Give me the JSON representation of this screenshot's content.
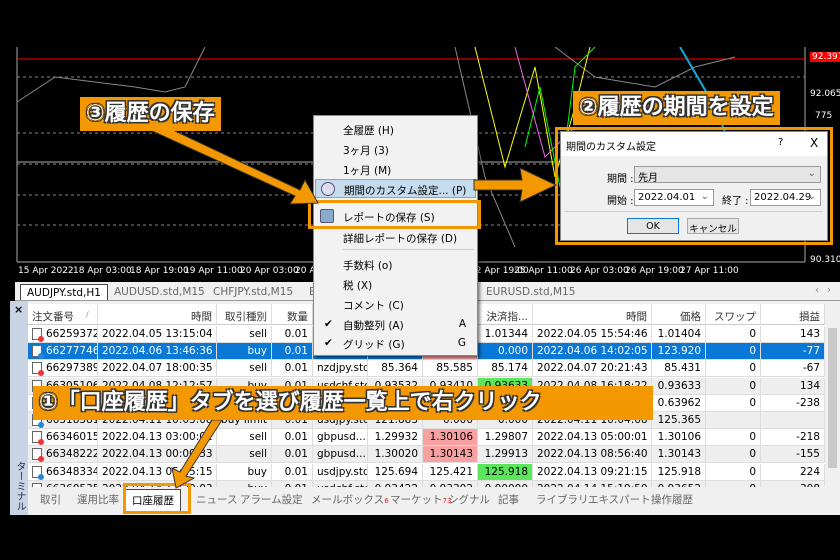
{
  "chart": {
    "price_labels": [
      "92.397",
      "92.065",
      "775",
      "90.310"
    ],
    "bid_line_color": "#ff0000",
    "time_labels": [
      "15 Apr 2022",
      "18 Apr 03:00",
      "18 Apr 19:00",
      "19 Apr 11:00",
      "20 Apr 03:00",
      "20 Apr 19:00",
      "22 Apr 19:00",
      "25 Apr 11:00",
      "26 Apr 03:00",
      "26 Apr 19:00",
      "27 Apr 11:00"
    ]
  },
  "chart_tabs": [
    "AUDJPY.std,H1",
    "AUDUSD.std,M15",
    "CHFJPY.std,M15",
    "E",
    "EURUSD.std,M15"
  ],
  "terminal": {
    "close": "×",
    "side_label": "ターミナル",
    "headers": [
      "注文番号",
      "時間",
      "取引種別",
      "数量",
      "",
      "",
      "",
      "決済指...",
      "時間",
      "価格",
      "スワップ",
      "損益"
    ],
    "sort_mark": "/",
    "rows": [
      {
        "c": [
          "66259372",
          "2022.04.05 13:15:04",
          "sell",
          "0.01",
          "",
          "",
          "",
          "1.01344",
          "2022.04.05 15:54:46",
          "1.01404",
          "0",
          "143"
        ],
        "icon": "sell"
      },
      {
        "c": [
          "66277746",
          "2022.04.06 13:46:36",
          "buy",
          "0.01",
          "",
          "",
          "",
          "0.000",
          "2022.04.06 14:02:05",
          "123.920",
          "0",
          "-77"
        ],
        "icon": "buy",
        "selected": true,
        "hl": {
          "6": "red"
        }
      },
      {
        "c": [
          "66297389",
          "2022.04.07 18:00:35",
          "sell",
          "0.01",
          "nzdjpy.std",
          "85.364",
          "85.585",
          "85.174",
          "2022.04.07 20:21:43",
          "85.431",
          "0",
          "-67"
        ],
        "icon": "sell"
      },
      {
        "c": [
          "66305106",
          "2022.04.08 12:12:57",
          "buy",
          "0.01",
          "usdchf.std",
          "0.93532",
          "0.93410",
          "0.93633",
          "2022.04.08 16:18:22",
          "0.93633",
          "0",
          "134"
        ],
        "icon": "buy",
        "hl": {
          "7": "green"
        }
      },
      {
        "c": [
          "",
          "",
          "",
          "",
          "",
          "",
          "",
          "",
          "",
          "0.63962",
          "0",
          "-238"
        ],
        "icon": "sell"
      },
      {
        "c": [
          "66318381",
          "2022.04.11 10:03:08",
          "buy limit",
          "0.01",
          "usdjpy.std",
          "121.883",
          "0.000",
          "0.000",
          "2022.04.11 10:04:08",
          "125.365",
          "",
          ""
        ],
        "icon": "buy"
      },
      {
        "c": [
          "66346015",
          "2022.04.13 03:00:01",
          "sell",
          "0.01",
          "gbpusd...",
          "1.29932",
          "1.30106",
          "1.29807",
          "2022.04.13 05:00:01",
          "1.30106",
          "0",
          "-218"
        ],
        "icon": "sell",
        "hl": {
          "6": "red"
        }
      },
      {
        "c": [
          "66348222",
          "2022.04.13 00:00:33",
          "sell",
          "0.01",
          "gbpusd...",
          "1.30020",
          "1.30143",
          "1.29913",
          "2022.04.13 08:56:40",
          "1.30143",
          "0",
          "-155"
        ],
        "icon": "sell",
        "hl": {
          "6": "red"
        }
      },
      {
        "c": [
          "66348334",
          "2022.04.13 05:15:15",
          "buy",
          "0.01",
          "usdjpy.std",
          "125.694",
          "125.421",
          "125.918",
          "2022.04.13 09:21:15",
          "125.918",
          "0",
          "224"
        ],
        "icon": "buy",
        "hl": {
          "7": "green"
        }
      },
      {
        "c": [
          "66360535",
          "2022.04.14 12:20:03",
          "buy",
          "0.01",
          "usdchf.std",
          "0.93422",
          "0.93302",
          "0.00000",
          "2022.04.14 15:19:50",
          "0.93652",
          "0",
          "308"
        ],
        "icon": "buy"
      }
    ]
  },
  "bottom_tabs": [
    {
      "label": "取引"
    },
    {
      "label": "運用比率"
    },
    {
      "label": "口座履歴",
      "selected": true
    },
    {
      "label": "ニュース"
    },
    {
      "label": "アラーム設定"
    },
    {
      "label": "メールボックス",
      "badge": "6"
    },
    {
      "label": "マーケット",
      "badge": "73"
    },
    {
      "label": "シグナル"
    },
    {
      "label": "記事"
    },
    {
      "label": "ライブラリ"
    },
    {
      "label": "エキスパート"
    },
    {
      "label": "操作履歴"
    }
  ],
  "context_menu": {
    "items": [
      {
        "label": "全履歴 (H)"
      },
      {
        "label": "3ヶ月 (3)"
      },
      {
        "label": "1ヶ月 (M)"
      },
      {
        "label": "期間のカスタム設定... (P)",
        "icon": "clock-icon",
        "highlighted": true
      },
      {
        "label": "レポートの保存 (S)",
        "icon": "save-report-icon"
      },
      {
        "label": "詳細レポートの保存 (D)"
      },
      {
        "label": "手数料 (o)"
      },
      {
        "label": "税 (X)"
      },
      {
        "label": "コメント (C)"
      },
      {
        "label": "自動整列 (A)",
        "checked": true,
        "shortcut": "A"
      },
      {
        "label": "グリッド (G)",
        "checked": true,
        "shortcut": "G"
      }
    ]
  },
  "dialog": {
    "title": "期間のカスタム設定",
    "help": "?",
    "close": "X",
    "period_label": "期間 :",
    "period_value": "先月",
    "start_label": "開始 :",
    "start_value": "2022.04.01",
    "end_label": "終了 :",
    "end_value": "2022.04.29",
    "ok": "OK",
    "cancel": "キャンセル"
  },
  "annotations": {
    "step1": "①「口座履歴」タブを選び履歴一覧上で右クリック",
    "step2": "②履歴の期間を設定",
    "step3": "③履歴の保存",
    "accent": "#f39800"
  }
}
